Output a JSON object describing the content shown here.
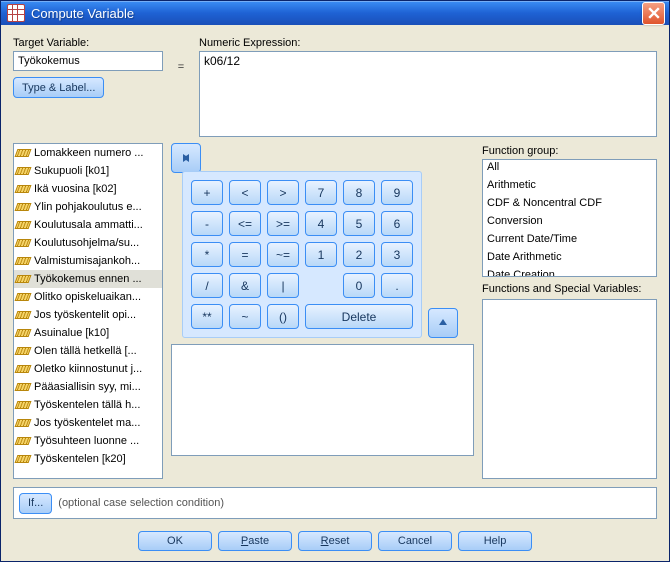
{
  "window": {
    "title": "Compute Variable"
  },
  "labels": {
    "target": "Target Variable:",
    "numexp": "Numeric Expression:",
    "equals": "=",
    "function_group": "Function group:",
    "fsv": "Functions and Special Variables:",
    "if_hint": "(optional case selection condition)"
  },
  "target": {
    "value": "Työkokemus"
  },
  "numexp": {
    "value": "k06/12"
  },
  "buttons": {
    "type_label": "Type & Label...",
    "if": "If...",
    "ok": "OK",
    "paste": "Paste",
    "reset": "Reset",
    "cancel": "Cancel",
    "help": "Help",
    "delete": "Delete"
  },
  "variables": [
    "Lomakkeen numero ...",
    "Sukupuoli [k01]",
    "Ikä vuosina [k02]",
    "Ylin pohjakoulutus e...",
    "Koulutusala ammatti...",
    "Koulutusohjelma/su...",
    "Valmistumisajankoh...",
    "Työkokemus ennen ...",
    "Olitko opiskeluaikan...",
    "Jos työskentelit opi...",
    "Asuinalue [k10]",
    "Olen tällä hetkellä [...",
    "Oletko kiinnostunut j...",
    "Pääasiallisin syy, mi...",
    "Työskentelen tällä h...",
    "Jos työskentelet ma...",
    "Työsuhteen luonne ...",
    "Työskentelen [k20]"
  ],
  "selected_variable_index": 7,
  "keypad": {
    "rows": [
      [
        "+",
        "<",
        ">",
        "7",
        "8",
        "9"
      ],
      [
        "-",
        "<=",
        ">=",
        "4",
        "5",
        "6"
      ],
      [
        "*",
        "=",
        "~=",
        "1",
        "2",
        "3"
      ],
      [
        "/",
        "&",
        "|",
        "",
        "0",
        "."
      ],
      [
        "**",
        "~",
        "()",
        "Delete",
        "",
        ""
      ]
    ]
  },
  "function_groups": [
    "All",
    "Arithmetic",
    "CDF & Noncentral CDF",
    "Conversion",
    "Current Date/Time",
    "Date Arithmetic",
    "Date Creation"
  ]
}
